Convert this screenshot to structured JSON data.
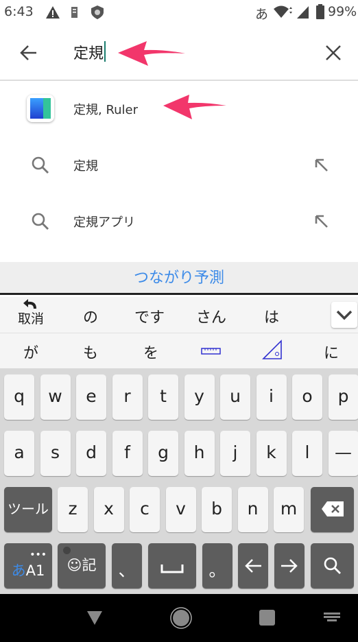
{
  "status_bar": {
    "time": "6:43",
    "ime_indicator": "あ",
    "battery": "99%",
    "icons": [
      "warning-icon",
      "notification-icon",
      "shield-icon",
      "wifi-icon",
      "signal-icon",
      "battery-icon"
    ]
  },
  "search_bar": {
    "query": "定規",
    "back_icon": "arrow-left-icon",
    "clear_icon": "close-icon"
  },
  "suggestions": [
    {
      "type": "app",
      "label": "定規, Ruler",
      "icon": "ruler-app-icon"
    },
    {
      "type": "query",
      "label": "定規",
      "icon": "search-icon",
      "action_icon": "arrow-up-left-icon"
    },
    {
      "type": "query",
      "label": "定規アプリ",
      "icon": "search-icon",
      "action_icon": "arrow-up-left-icon"
    }
  ],
  "keyboard": {
    "prediction_header": "つながり予測",
    "undo_label": "取消",
    "candidates_row1": [
      "の",
      "です",
      "さん",
      "は"
    ],
    "candidates_row2": [
      "が",
      "も",
      "を",
      "📏",
      "📐",
      "に"
    ],
    "row1": [
      "q",
      "w",
      "e",
      "r",
      "t",
      "y",
      "u",
      "i",
      "o",
      "p"
    ],
    "row2": [
      "a",
      "s",
      "d",
      "f",
      "g",
      "h",
      "j",
      "k",
      "l",
      "—"
    ],
    "row3_left": "ツール",
    "row3": [
      "z",
      "x",
      "c",
      "v",
      "b",
      "n",
      "m"
    ],
    "mode_key_a": "あ",
    "mode_key_b": "A1",
    "emoji_key": "☺記",
    "comma": "、",
    "period": "。",
    "accent": "#3d8be8"
  }
}
